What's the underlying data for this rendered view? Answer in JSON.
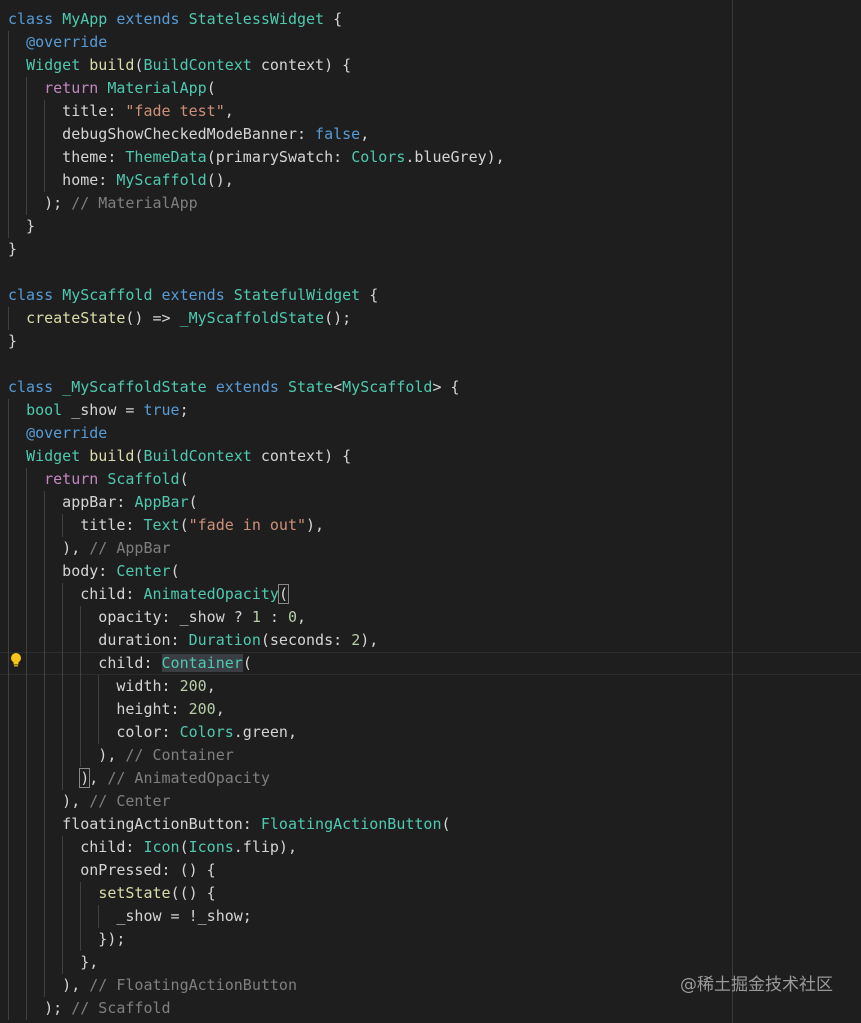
{
  "colors": {
    "background": "#1e1e1e",
    "keyword": "#569cd6",
    "type": "#4ec9b0",
    "control": "#c586c0",
    "string": "#ce9178",
    "function": "#dcdcaa",
    "number": "#b5cea8",
    "comment": "#7f7f7f"
  },
  "watermark": "@稀土掘金技术社区",
  "code": {
    "current_line": 28,
    "lines": [
      {
        "tk": [
          [
            "k",
            "class"
          ],
          [
            "p",
            " "
          ],
          [
            "t",
            "MyApp"
          ],
          [
            "p",
            " "
          ],
          [
            "k",
            "extends"
          ],
          [
            "p",
            " "
          ],
          [
            "t",
            "StatelessWidget"
          ],
          [
            "p",
            " {"
          ]
        ]
      },
      {
        "tk": [
          [
            "p",
            "  "
          ],
          [
            "d",
            "@override"
          ]
        ]
      },
      {
        "tk": [
          [
            "p",
            "  "
          ],
          [
            "t",
            "Widget"
          ],
          [
            "p",
            " "
          ],
          [
            "f",
            "build"
          ],
          [
            "p",
            "("
          ],
          [
            "t",
            "BuildContext"
          ],
          [
            "p",
            " context) {"
          ]
        ]
      },
      {
        "tk": [
          [
            "p",
            "    "
          ],
          [
            "r",
            "return"
          ],
          [
            "p",
            " "
          ],
          [
            "t",
            "MaterialApp"
          ],
          [
            "p",
            "("
          ]
        ]
      },
      {
        "tk": [
          [
            "p",
            "      title: "
          ],
          [
            "s",
            "\"fade test\""
          ],
          [
            "p",
            ","
          ]
        ]
      },
      {
        "tk": [
          [
            "p",
            "      debugShowCheckedModeBanner: "
          ],
          [
            "k",
            "false"
          ],
          [
            "p",
            ","
          ]
        ]
      },
      {
        "tk": [
          [
            "p",
            "      theme: "
          ],
          [
            "t",
            "ThemeData"
          ],
          [
            "p",
            "(primarySwatch: "
          ],
          [
            "t",
            "Colors"
          ],
          [
            "p",
            ".blueGrey),"
          ]
        ]
      },
      {
        "tk": [
          [
            "p",
            "      home: "
          ],
          [
            "t",
            "MyScaffold"
          ],
          [
            "p",
            "(),"
          ]
        ]
      },
      {
        "tk": [
          [
            "p",
            "    ); "
          ],
          [
            "c",
            "// MaterialApp"
          ]
        ]
      },
      {
        "tk": [
          [
            "p",
            "  }"
          ]
        ]
      },
      {
        "tk": [
          [
            "p",
            "}"
          ]
        ]
      },
      {
        "tk": [
          [
            "p",
            ""
          ]
        ]
      },
      {
        "tk": [
          [
            "k",
            "class"
          ],
          [
            "p",
            " "
          ],
          [
            "t",
            "MyScaffold"
          ],
          [
            "p",
            " "
          ],
          [
            "k",
            "extends"
          ],
          [
            "p",
            " "
          ],
          [
            "t",
            "StatefulWidget"
          ],
          [
            "p",
            " {"
          ]
        ]
      },
      {
        "tk": [
          [
            "p",
            "  "
          ],
          [
            "f",
            "createState"
          ],
          [
            "p",
            "() => "
          ],
          [
            "t",
            "_MyScaffoldState"
          ],
          [
            "p",
            "();"
          ]
        ]
      },
      {
        "tk": [
          [
            "p",
            "}"
          ]
        ]
      },
      {
        "tk": [
          [
            "p",
            ""
          ]
        ]
      },
      {
        "tk": [
          [
            "k",
            "class"
          ],
          [
            "p",
            " "
          ],
          [
            "t",
            "_MyScaffoldState"
          ],
          [
            "p",
            " "
          ],
          [
            "k",
            "extends"
          ],
          [
            "p",
            " "
          ],
          [
            "t",
            "State"
          ],
          [
            "p",
            "<"
          ],
          [
            "t",
            "MyScaffold"
          ],
          [
            "p",
            "> {"
          ]
        ]
      },
      {
        "tk": [
          [
            "p",
            "  "
          ],
          [
            "t",
            "bool"
          ],
          [
            "p",
            " _show = "
          ],
          [
            "k",
            "true"
          ],
          [
            "p",
            ";"
          ]
        ]
      },
      {
        "tk": [
          [
            "p",
            "  "
          ],
          [
            "d",
            "@override"
          ]
        ]
      },
      {
        "tk": [
          [
            "p",
            "  "
          ],
          [
            "t",
            "Widget"
          ],
          [
            "p",
            " "
          ],
          [
            "f",
            "build"
          ],
          [
            "p",
            "("
          ],
          [
            "t",
            "BuildContext"
          ],
          [
            "p",
            " context) {"
          ]
        ]
      },
      {
        "tk": [
          [
            "p",
            "    "
          ],
          [
            "r",
            "return"
          ],
          [
            "p",
            " "
          ],
          [
            "t",
            "Scaffold"
          ],
          [
            "p",
            "("
          ]
        ]
      },
      {
        "tk": [
          [
            "p",
            "      appBar: "
          ],
          [
            "t",
            "AppBar"
          ],
          [
            "p",
            "("
          ]
        ]
      },
      {
        "tk": [
          [
            "p",
            "        title: "
          ],
          [
            "t",
            "Text"
          ],
          [
            "p",
            "("
          ],
          [
            "s",
            "\"fade in out\""
          ],
          [
            "p",
            "),"
          ]
        ]
      },
      {
        "tk": [
          [
            "p",
            "      ), "
          ],
          [
            "c",
            "// AppBar"
          ]
        ]
      },
      {
        "tk": [
          [
            "p",
            "      body: "
          ],
          [
            "t",
            "Center"
          ],
          [
            "p",
            "("
          ]
        ]
      },
      {
        "tk": [
          [
            "p",
            "        child: "
          ],
          [
            "t",
            "AnimatedOpacity"
          ],
          [
            "bm",
            "("
          ]
        ]
      },
      {
        "tk": [
          [
            "p",
            "          opacity: _show ? "
          ],
          [
            "n",
            "1"
          ],
          [
            "p",
            " : "
          ],
          [
            "n",
            "0"
          ],
          [
            "p",
            ","
          ]
        ]
      },
      {
        "tk": [
          [
            "p",
            "          duration: "
          ],
          [
            "t",
            "Duration"
          ],
          [
            "p",
            "(seconds: "
          ],
          [
            "n",
            "2"
          ],
          [
            "p",
            "),"
          ]
        ]
      },
      {
        "tk": [
          [
            "p",
            "          child: "
          ],
          [
            "th",
            "Container"
          ],
          [
            "p",
            "("
          ]
        ]
      },
      {
        "tk": [
          [
            "p",
            "            width: "
          ],
          [
            "n",
            "200"
          ],
          [
            "p",
            ","
          ]
        ]
      },
      {
        "tk": [
          [
            "p",
            "            height: "
          ],
          [
            "n",
            "200"
          ],
          [
            "p",
            ","
          ]
        ]
      },
      {
        "tk": [
          [
            "p",
            "            color: "
          ],
          [
            "t",
            "Colors"
          ],
          [
            "p",
            ".green,"
          ]
        ]
      },
      {
        "tk": [
          [
            "p",
            "          ), "
          ],
          [
            "c",
            "// Container"
          ]
        ]
      },
      {
        "tk": [
          [
            "p",
            "        "
          ],
          [
            "bm",
            ")"
          ],
          [
            "p",
            ", "
          ],
          [
            "c",
            "// AnimatedOpacity"
          ]
        ]
      },
      {
        "tk": [
          [
            "p",
            "      ), "
          ],
          [
            "c",
            "// Center"
          ]
        ]
      },
      {
        "tk": [
          [
            "p",
            "      floatingActionButton: "
          ],
          [
            "t",
            "FloatingActionButton"
          ],
          [
            "p",
            "("
          ]
        ]
      },
      {
        "tk": [
          [
            "p",
            "        child: "
          ],
          [
            "t",
            "Icon"
          ],
          [
            "p",
            "("
          ],
          [
            "t",
            "Icons"
          ],
          [
            "p",
            ".flip),"
          ]
        ]
      },
      {
        "tk": [
          [
            "p",
            "        onPressed: () {"
          ]
        ]
      },
      {
        "tk": [
          [
            "p",
            "          "
          ],
          [
            "f",
            "setState"
          ],
          [
            "p",
            "(() {"
          ]
        ]
      },
      {
        "tk": [
          [
            "p",
            "            _show = !_show;"
          ]
        ]
      },
      {
        "tk": [
          [
            "p",
            "          });"
          ]
        ]
      },
      {
        "tk": [
          [
            "p",
            "        },"
          ]
        ]
      },
      {
        "tk": [
          [
            "p",
            "      ), "
          ],
          [
            "c",
            "// FloatingActionButton"
          ]
        ]
      },
      {
        "tk": [
          [
            "p",
            "    ); "
          ],
          [
            "c",
            "// Scaffold"
          ]
        ]
      }
    ]
  }
}
